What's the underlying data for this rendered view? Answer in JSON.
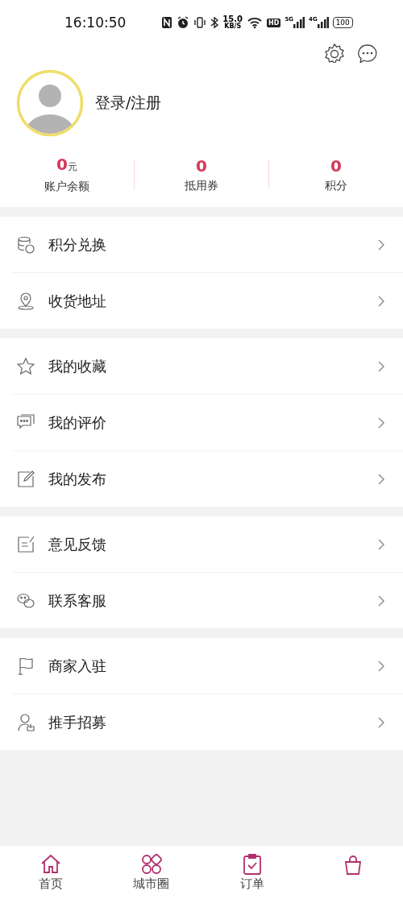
{
  "status_bar": {
    "time": "16:10:50",
    "speed": "15.0",
    "speed_unit": "KB/S",
    "hd": "HD",
    "net_1": "5G",
    "net_2": "4G",
    "battery": "100"
  },
  "profile": {
    "login": "登录/注册"
  },
  "stats": [
    {
      "value": "0",
      "unit": "元",
      "label": "账户余额"
    },
    {
      "value": "0",
      "label": "抵用券"
    },
    {
      "value": "0",
      "label": "积分"
    }
  ],
  "menu_sections": [
    {
      "items": [
        {
          "label": "积分兑换"
        },
        {
          "label": "收货地址"
        }
      ]
    },
    {
      "items": [
        {
          "label": "我的收藏"
        },
        {
          "label": "我的评价"
        },
        {
          "label": "我的发布"
        }
      ]
    },
    {
      "items": [
        {
          "label": "意见反馈"
        },
        {
          "label": "联系客服"
        }
      ]
    },
    {
      "items": [
        {
          "label": "商家入驻"
        },
        {
          "label": "推手招募"
        }
      ]
    }
  ],
  "tab_bar": [
    {
      "kind": "labeled",
      "label": "首页"
    },
    {
      "kind": "labeled",
      "label": "城市圈"
    },
    {
      "kind": "labeled",
      "label": "订单"
    },
    {
      "kind": "icon_only"
    }
  ]
}
